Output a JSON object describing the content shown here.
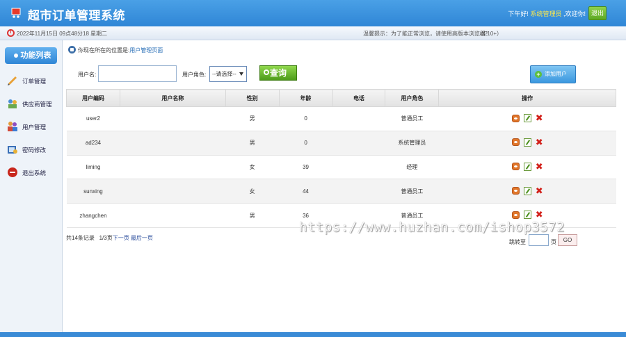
{
  "header": {
    "title": "超市订单管理系统",
    "greeting": "下午好!",
    "role": "系统管理员",
    "welcome": ",欢迎你!",
    "logout_label": "退出"
  },
  "infobar": {
    "datetime": "2022年11月15日 09点48分18 星期二",
    "notice": "温馨提示：为了能正常浏览，请使用高版本浏览器！",
    "notice_ie": "（IE10+）"
  },
  "sidebar": {
    "title": "功能列表",
    "items": [
      {
        "label": "订单管理",
        "icon": "order-icon"
      },
      {
        "label": "供应商管理",
        "icon": "supplier-icon"
      },
      {
        "label": "用户管理",
        "icon": "users-icon"
      },
      {
        "label": "密码修改",
        "icon": "password-icon"
      },
      {
        "label": "退出系统",
        "icon": "exit-icon"
      }
    ]
  },
  "breadcrumb": {
    "prefix": "你现在所在的位置是:",
    "current": "用户管理页面"
  },
  "search": {
    "username_label": "用户名:",
    "username_value": "",
    "role_label": "用户角色:",
    "role_selected": "--请选择--",
    "query_label": "查询",
    "add_label": "添加用户"
  },
  "table": {
    "headers": [
      "用户编码",
      "用户名称",
      "性别",
      "年龄",
      "电话",
      "用户角色",
      "操作"
    ],
    "rows": [
      {
        "code": "user2",
        "name": "",
        "gender": "男",
        "age": "0",
        "phone": "",
        "role": "普通员工"
      },
      {
        "code": "ad234",
        "name": "",
        "gender": "男",
        "age": "0",
        "phone": "",
        "role": "系统管理员"
      },
      {
        "code": "liming",
        "name": "",
        "gender": "女",
        "age": "39",
        "phone": "",
        "role": "经理"
      },
      {
        "code": "sunxing",
        "name": "",
        "gender": "女",
        "age": "44",
        "phone": "",
        "role": "普通员工"
      },
      {
        "code": "zhangchen",
        "name": "",
        "gender": "男",
        "age": "36",
        "phone": "",
        "role": "普通员工"
      }
    ]
  },
  "pagination": {
    "total": "共14条记录",
    "pages": "1/3页",
    "next": "下一页",
    "last": "最后一页",
    "jump_label": "跳转至",
    "jump_unit": "页",
    "go_label": "GO"
  },
  "watermark": "https://www.huzhan.com/ishop3572"
}
